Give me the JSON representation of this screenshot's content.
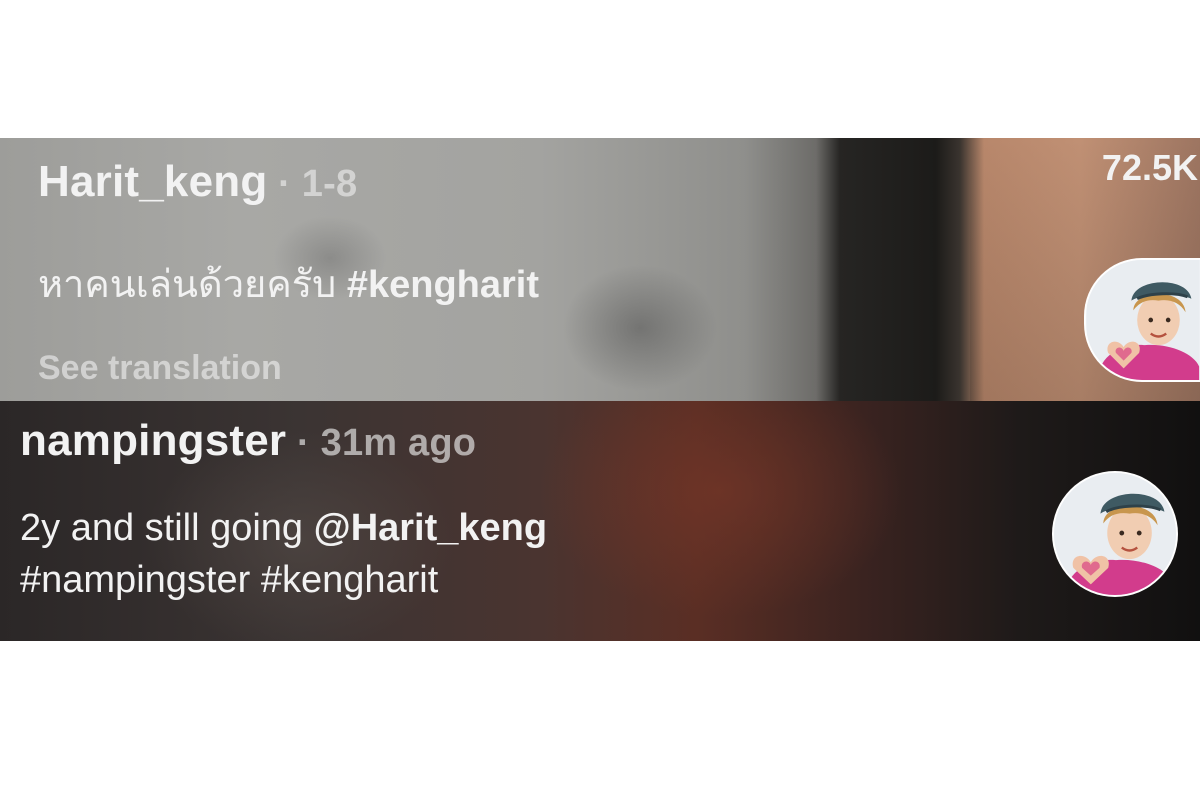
{
  "comment_top": {
    "username": "Harit_keng",
    "meta": " · 1-8",
    "caption_text": "หาคนเล่นด้วยครับ ",
    "caption_tag": "#kengharit",
    "see_translation": "See translation",
    "likes": "72.5K",
    "avatar_icon": "profile-avatar"
  },
  "comment_bottom": {
    "username": "nampingster",
    "meta": " · 31m ago",
    "line1_text": "2y and still going ",
    "line1_mention": "@Harit_keng",
    "line2_tag1": "#nampingster",
    "line2_space": " ",
    "line2_tag2": "#kengharit",
    "avatar_icon": "profile-avatar"
  }
}
